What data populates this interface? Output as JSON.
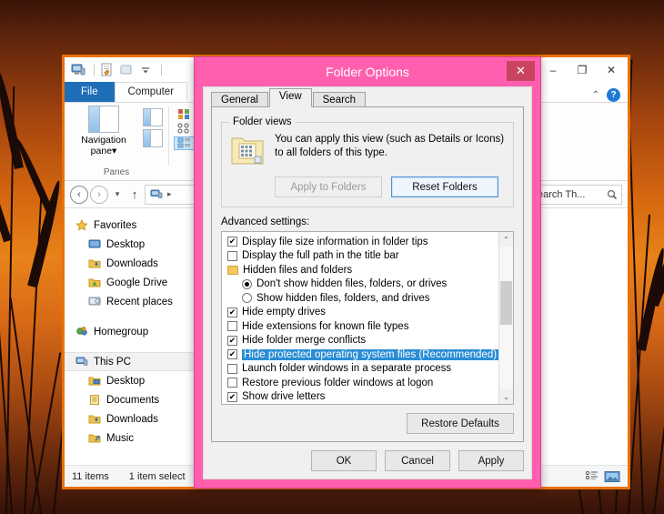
{
  "desktop": {
    "wallpaper_description": "sunset-silhouette-reeds"
  },
  "explorer": {
    "quick_access": [
      {
        "name": "this-pc-icon",
        "label": "This PC"
      },
      {
        "name": "properties-icon",
        "label": "Properties"
      },
      {
        "name": "new-folder-icon",
        "label": "New folder"
      },
      {
        "name": "customize-dropdown-icon",
        "label": "Customize Quick Access Toolbar"
      }
    ],
    "window_controls": {
      "minimize": "–",
      "maximize": "❐",
      "close": "✕"
    },
    "ribbon_tabs": [
      {
        "label": "File",
        "active": false,
        "style": "file"
      },
      {
        "label": "Computer",
        "active": true,
        "style": "normal"
      }
    ],
    "ribbon_right": {
      "collapse_icon": "⌃",
      "help_icon": "?"
    },
    "ribbon": {
      "panes_group": {
        "label": "Panes",
        "navigation_pane_line1": "Navigation",
        "navigation_pane_line2": "pane",
        "dropdown_caret": "▾"
      },
      "layout_group": {
        "items": [
          {
            "label": "Med",
            "selected": false
          },
          {
            "label": "List",
            "selected": false
          },
          {
            "label": "Tiles",
            "selected": true
          }
        ]
      }
    },
    "address_bar": {
      "back": "‹",
      "forward": "›",
      "history": "▾",
      "up": "↑",
      "breadcrumb_chevron": "▸",
      "breadcrumb_root": "This PC"
    },
    "search": {
      "value": "earch Th...",
      "placeholder": "Search This PC",
      "icon": "search-icon"
    },
    "navigation_pane": {
      "sections": [
        {
          "header": {
            "label": "Favorites",
            "icon": "star-icon"
          },
          "items": [
            {
              "label": "Desktop",
              "icon": "desktop-icon"
            },
            {
              "label": "Downloads",
              "icon": "downloads-icon"
            },
            {
              "label": "Google Drive",
              "icon": "google-drive-icon"
            },
            {
              "label": "Recent places",
              "icon": "recent-places-icon"
            }
          ]
        },
        {
          "header": {
            "label": "Homegroup",
            "icon": "homegroup-icon"
          },
          "items": []
        },
        {
          "header": {
            "label": "This PC",
            "icon": "this-pc-icon",
            "selected": true
          },
          "items": [
            {
              "label": "Desktop",
              "icon": "desktop-folder-icon"
            },
            {
              "label": "Documents",
              "icon": "documents-folder-icon"
            },
            {
              "label": "Downloads",
              "icon": "downloads-folder-icon"
            },
            {
              "label": "Music",
              "icon": "music-folder-icon"
            }
          ]
        }
      ]
    },
    "status_bar": {
      "items_count": "11 items",
      "selection": "1 item select",
      "view_buttons": [
        {
          "name": "details-view-button",
          "label": "Details view"
        },
        {
          "name": "large-icons-view-button",
          "label": "Large icons view"
        }
      ]
    }
  },
  "dialog": {
    "title": "Folder Options",
    "close_label": "✕",
    "tabs": [
      {
        "label": "General",
        "active": false
      },
      {
        "label": "View",
        "active": true
      },
      {
        "label": "Search",
        "active": false
      }
    ],
    "folder_views": {
      "legend": "Folder views",
      "description": "You can apply this view (such as Details or Icons) to all folders of this type.",
      "apply_button": "Apply to Folders",
      "apply_button_enabled": false,
      "reset_button": "Reset Folders",
      "reset_button_focused": true
    },
    "advanced": {
      "label": "Advanced settings:",
      "items": [
        {
          "type": "checkbox",
          "label": "Display file size information in folder tips",
          "checked": true,
          "indent": false,
          "selected": false
        },
        {
          "type": "checkbox",
          "label": "Display the full path in the title bar",
          "checked": false,
          "indent": false,
          "selected": false
        },
        {
          "type": "folder",
          "label": "Hidden files and folders",
          "checked": false,
          "indent": false,
          "selected": false
        },
        {
          "type": "radio",
          "label": "Don't show hidden files, folders, or drives",
          "checked": true,
          "indent": true,
          "selected": false
        },
        {
          "type": "radio",
          "label": "Show hidden files, folders, and drives",
          "checked": false,
          "indent": true,
          "selected": false
        },
        {
          "type": "checkbox",
          "label": "Hide empty drives",
          "checked": true,
          "indent": false,
          "selected": false
        },
        {
          "type": "checkbox",
          "label": "Hide extensions for known file types",
          "checked": false,
          "indent": false,
          "selected": false
        },
        {
          "type": "checkbox",
          "label": "Hide folder merge conflicts",
          "checked": true,
          "indent": false,
          "selected": false
        },
        {
          "type": "checkbox",
          "label": "Hide protected operating system files (Recommended)",
          "checked": true,
          "indent": false,
          "selected": true
        },
        {
          "type": "checkbox",
          "label": "Launch folder windows in a separate process",
          "checked": false,
          "indent": false,
          "selected": false
        },
        {
          "type": "checkbox",
          "label": "Restore previous folder windows at logon",
          "checked": false,
          "indent": false,
          "selected": false
        },
        {
          "type": "checkbox",
          "label": "Show drive letters",
          "checked": true,
          "indent": false,
          "selected": false
        }
      ],
      "scroll_up_arrow": "⌃",
      "scroll_down_arrow": "⌄"
    },
    "restore_defaults_button": "Restore Defaults",
    "buttons": [
      {
        "label": "OK",
        "name": "ok-button"
      },
      {
        "label": "Cancel",
        "name": "cancel-button"
      },
      {
        "label": "Apply",
        "name": "apply-button"
      }
    ],
    "colors": {
      "title_bar": "#ff5fae",
      "close_button": "#c9455f",
      "selection_highlight": "#2a8dd4"
    }
  }
}
